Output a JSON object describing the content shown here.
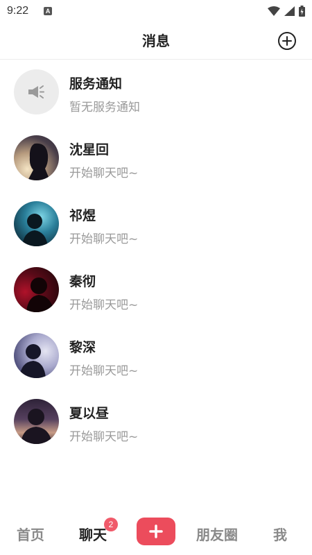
{
  "status_bar": {
    "time": "9:22",
    "notification_icon": "a-icon"
  },
  "header": {
    "title": "消息",
    "add_icon": "add-circle-icon"
  },
  "chats": [
    {
      "name": "服务通知",
      "preview": "暂无服务通知",
      "avatar": "megaphone-icon"
    },
    {
      "name": "沈星回",
      "preview": "开始聊天吧~"
    },
    {
      "name": "祁煜",
      "preview": "开始聊天吧~"
    },
    {
      "name": "秦彻",
      "preview": "开始聊天吧~"
    },
    {
      "name": "黎深",
      "preview": "开始聊天吧~"
    },
    {
      "name": "夏以昼",
      "preview": "开始聊天吧~"
    }
  ],
  "nav": {
    "home": "首页",
    "chat": "聊天",
    "chat_badge": "2",
    "add_icon": "plus-icon",
    "moments": "朋友圈",
    "me": "我"
  },
  "colors": {
    "accent": "#ec4c5c",
    "badge": "#f05a6a",
    "muted_text": "#9a9a9a"
  }
}
